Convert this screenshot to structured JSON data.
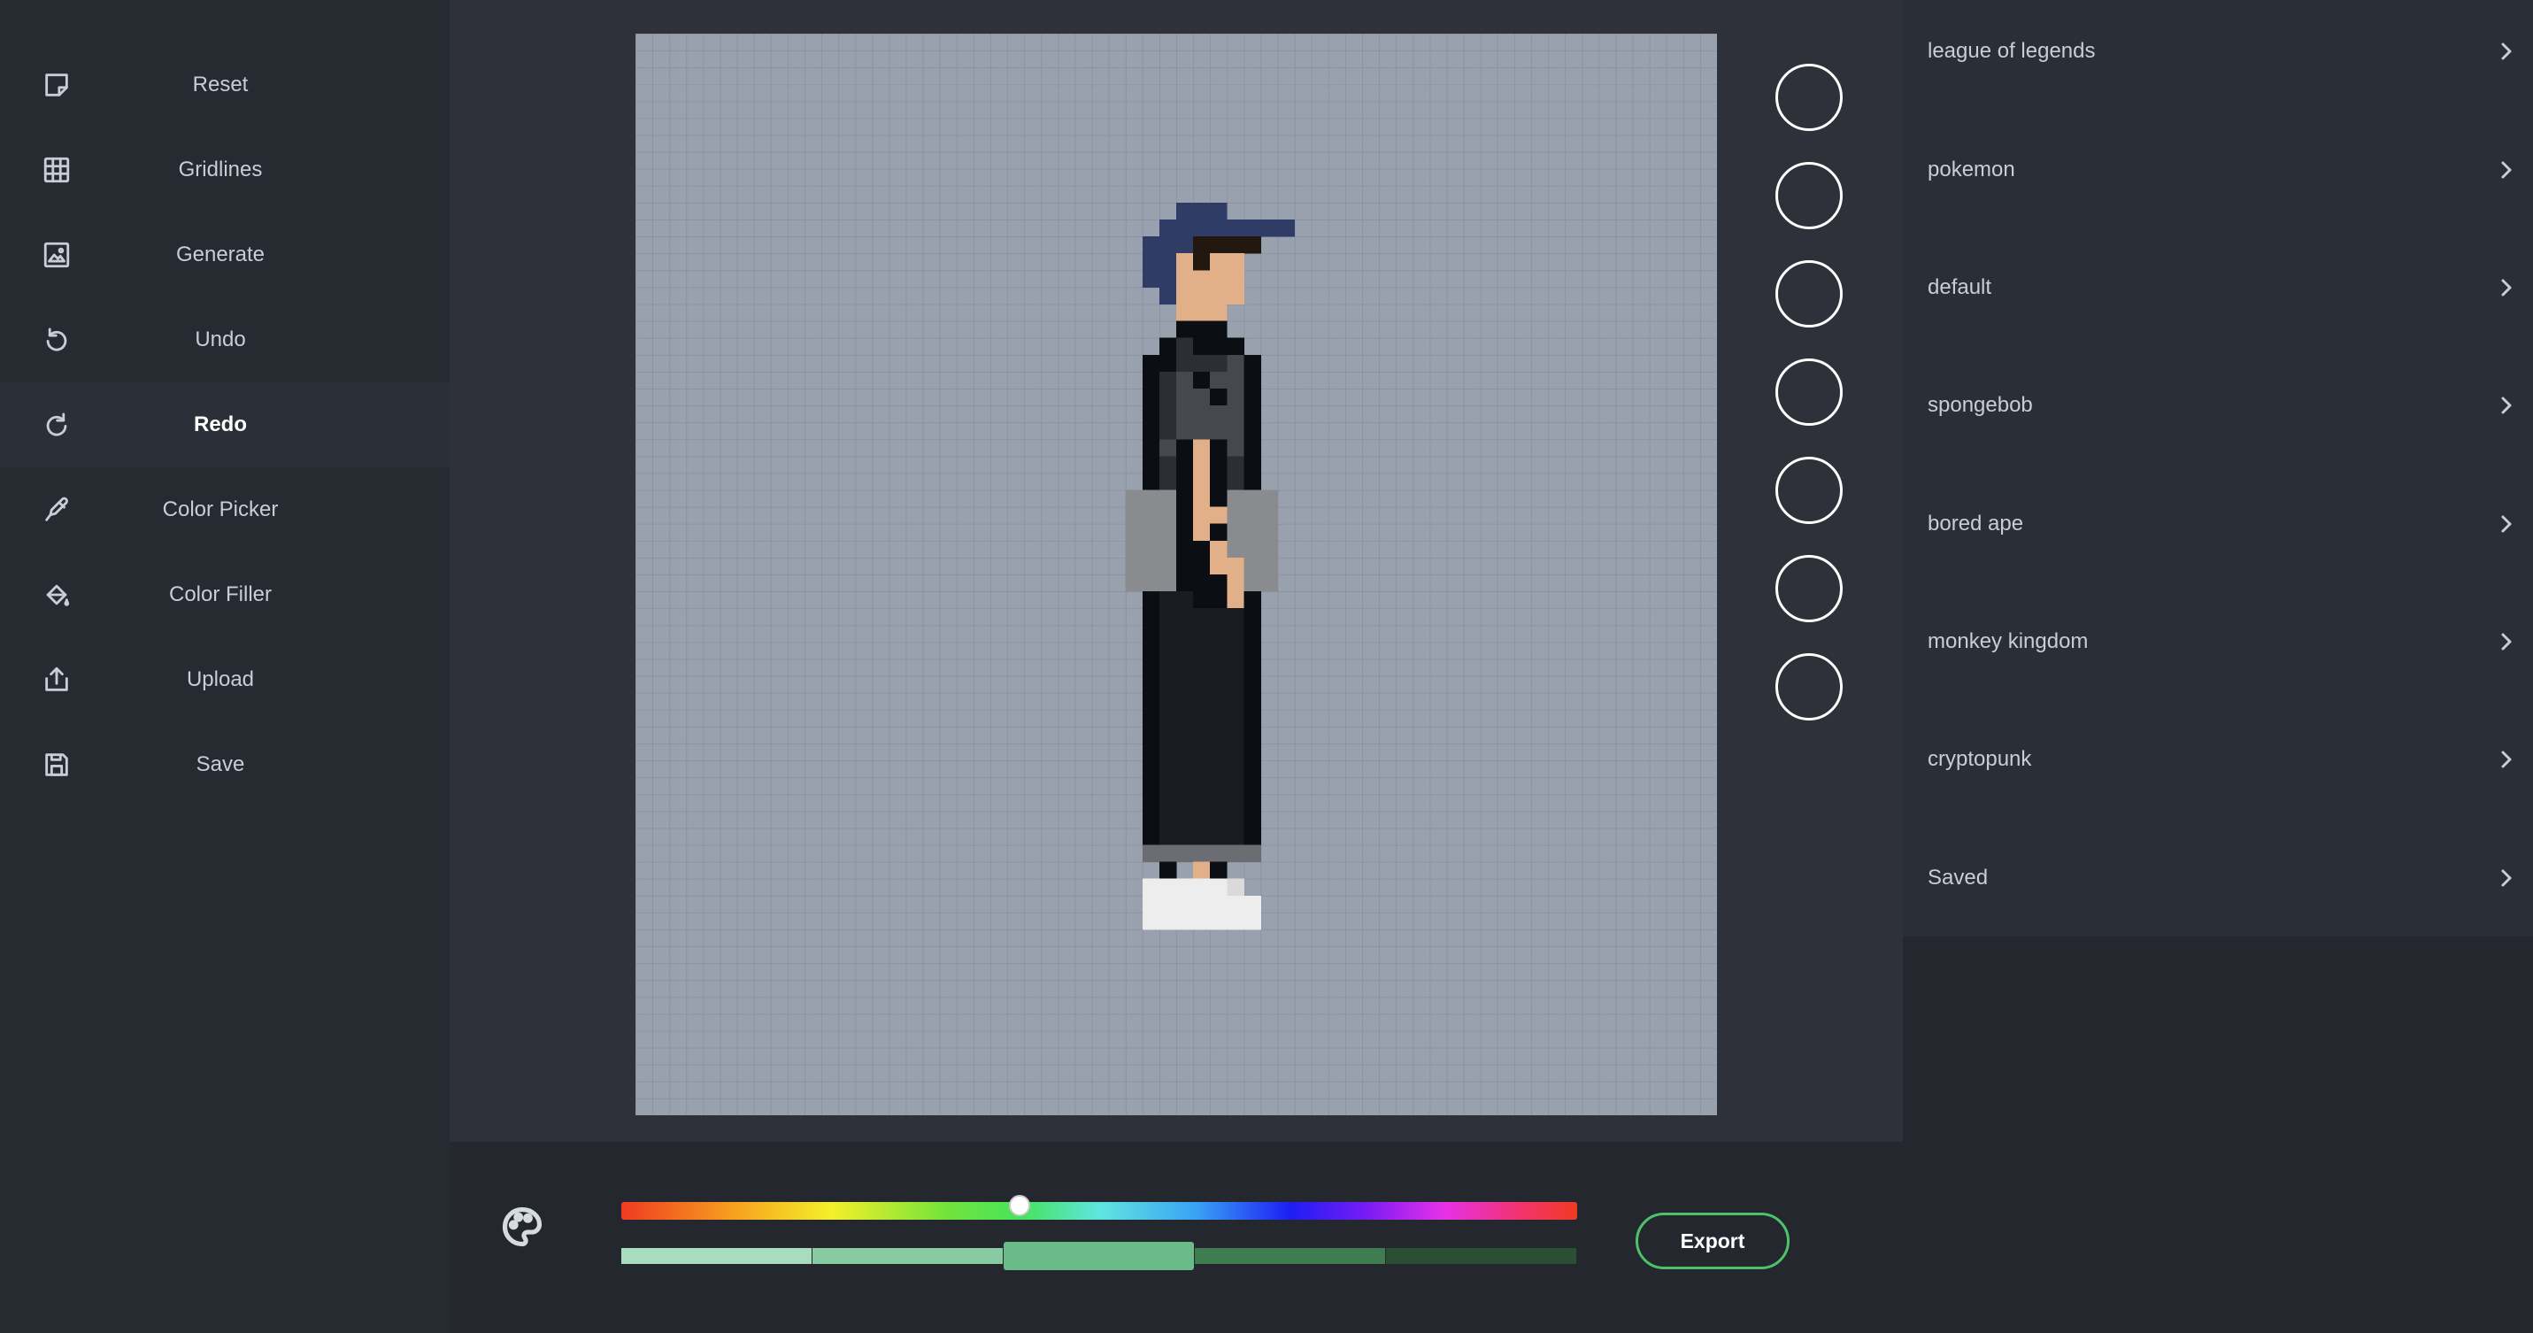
{
  "toolbar": {
    "items": [
      {
        "label": "Reset",
        "icon": "note-icon"
      },
      {
        "label": "Gridlines",
        "icon": "grid-icon"
      },
      {
        "label": "Generate",
        "icon": "image-icon"
      },
      {
        "label": "Undo",
        "icon": "undo-icon"
      },
      {
        "label": "Redo",
        "icon": "redo-icon"
      },
      {
        "label": "Color Picker",
        "icon": "eyedropper-icon"
      },
      {
        "label": "Color Filler",
        "icon": "paint-bucket-icon"
      },
      {
        "label": "Upload",
        "icon": "upload-icon"
      },
      {
        "label": "Save",
        "icon": "save-icon"
      }
    ],
    "active_item": "Redo"
  },
  "canvas": {
    "background_color": "#9aa1ae",
    "gridlines": true,
    "sprite_palette": {
      "K": "#0b0e12",
      "D": "#2b2e33",
      "G": "#45484d",
      "N": "#1a1c24",
      "B": "#2f3d66",
      "H": "#22180f",
      "S": "#e1b089",
      "s": "#d29c74",
      "P": "#8a8b8f",
      "C": "#6b6d72",
      "W": "#ededed",
      "w": "#dadada"
    }
  },
  "swatches": {
    "count": 7,
    "border_color": "#ffffff"
  },
  "color_picker": {
    "icon": "palette-icon",
    "hue_position": 0.417,
    "shades": [
      "#a8dcbf",
      "#88cba2",
      "#6bbb88",
      "#3f7d50",
      "#2a4f33"
    ],
    "selected_shade_index": 2
  },
  "export_button": {
    "label": "Export",
    "border_color": "#4cc36a"
  },
  "categories": {
    "items": [
      "league of legends",
      "pokemon",
      "default",
      "spongebob",
      "bored ape",
      "monkey kingdom",
      "cryptopunk",
      "Saved"
    ],
    "chevron_icon": "chevron-right-icon"
  }
}
